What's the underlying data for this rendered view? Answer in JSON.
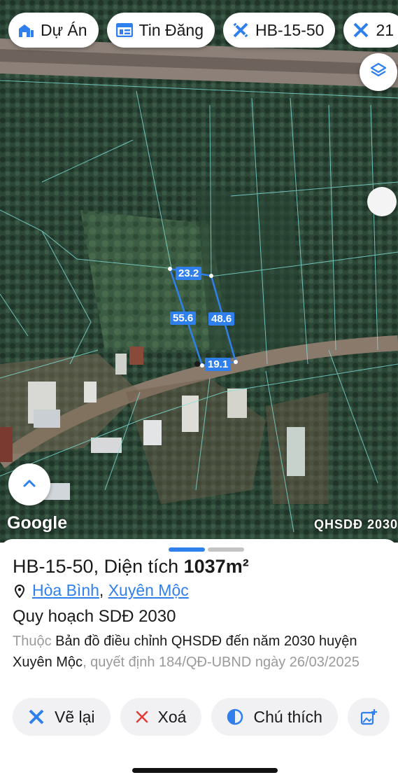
{
  "chips": [
    {
      "label": "Dự Án",
      "icon": "building-icon"
    },
    {
      "label": "Tin Đăng",
      "icon": "listing-icon"
    },
    {
      "label": "HB-15-50",
      "icon": "measure-icon"
    },
    {
      "label": "21",
      "icon": "measure-icon"
    }
  ],
  "map": {
    "google_label": "Google",
    "overlay_label": "QHSDĐ 2030",
    "measurements": {
      "top": "23.2",
      "left": "55.6",
      "right": "48.6",
      "bottom": "19.1"
    }
  },
  "sheet": {
    "code": "HB-15-50",
    "area_prefix": ", Diện tích ",
    "area_value": "1037m²",
    "ward": "Hòa Bình",
    "separator": ", ",
    "district": "Xuyên Mộc",
    "plan_title": "Quy hoạch SDĐ 2030",
    "desc_prefix": "Thuộc ",
    "desc_main": "Bản đồ điều chỉnh QHSDĐ đến năm 2030 huyện Xuyên Mộc",
    "desc_suffix": ", quyết định 184/QĐ-UBND ngày 26/03/2025"
  },
  "actions": [
    {
      "label": "Vẽ lại",
      "icon": "redraw-icon"
    },
    {
      "label": "Xoá",
      "icon": "close-icon"
    },
    {
      "label": "Chú thích",
      "icon": "legend-icon"
    },
    {
      "label": "",
      "icon": "add-image-icon"
    }
  ],
  "colors": {
    "accent": "#2f80ed",
    "delete": "#e53935",
    "parcel_line": "#7fe0d8"
  }
}
